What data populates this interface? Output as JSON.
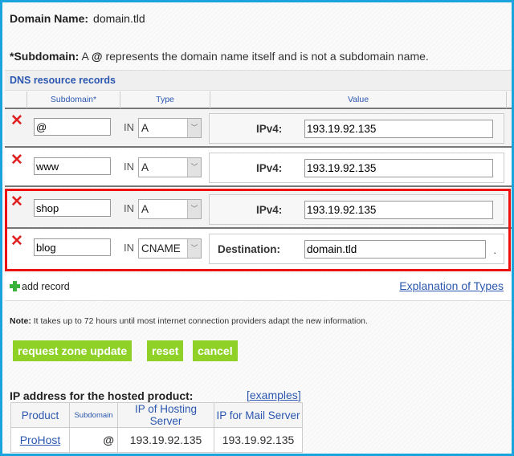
{
  "domain": {
    "label": "Domain Name:",
    "value": "domain.tld"
  },
  "subdomain_note": {
    "bold": "*Subdomain:",
    "prefix": " A ",
    "at": "@",
    "text": " represents the domain name itself and is not a subdomain name."
  },
  "dns": {
    "title": "DNS resource records",
    "columns": [
      "Subdomain*",
      "Type",
      "Value"
    ],
    "records": [
      {
        "subdomain": "@",
        "class": "IN",
        "type": "A",
        "value_label": "IPv4:",
        "value": "193.19.92.135"
      },
      {
        "subdomain": "www",
        "class": "IN",
        "type": "A",
        "value_label": "IPv4:",
        "value": "193.19.92.135"
      },
      {
        "subdomain": "shop",
        "class": "IN",
        "type": "A",
        "value_label": "IPv4:",
        "value": "193.19.92.135"
      },
      {
        "subdomain": "blog",
        "class": "IN",
        "type": "CNAME",
        "value_label": "Destination:",
        "value": "domain.tld",
        "suffix": "."
      }
    ],
    "add_record": "add record",
    "explanation_link": "Explanation of Types"
  },
  "note": {
    "bold": "Note:",
    "text": " It takes up to 72 hours until most internet connection providers adapt the new information."
  },
  "buttons": {
    "request": "request zone update",
    "reset": "reset",
    "cancel": "cancel"
  },
  "ip_section": {
    "title": "IP address for the hosted product:",
    "examples_open": "[",
    "examples": "examples",
    "examples_close": "]",
    "headers": [
      "Product",
      "Subdomain",
      "IP of Hosting Server",
      "IP for Mail Server"
    ],
    "rows": [
      {
        "product": "ProHost",
        "subdomain": "@",
        "hosting_ip": "193.19.92.135",
        "mail_ip": "193.19.92.135"
      }
    ]
  },
  "colors": {
    "frame": "#1aa3dc",
    "highlight": "#ee1111",
    "button": "#8fd127",
    "link": "#2b57b0",
    "delete": "#e02020"
  }
}
